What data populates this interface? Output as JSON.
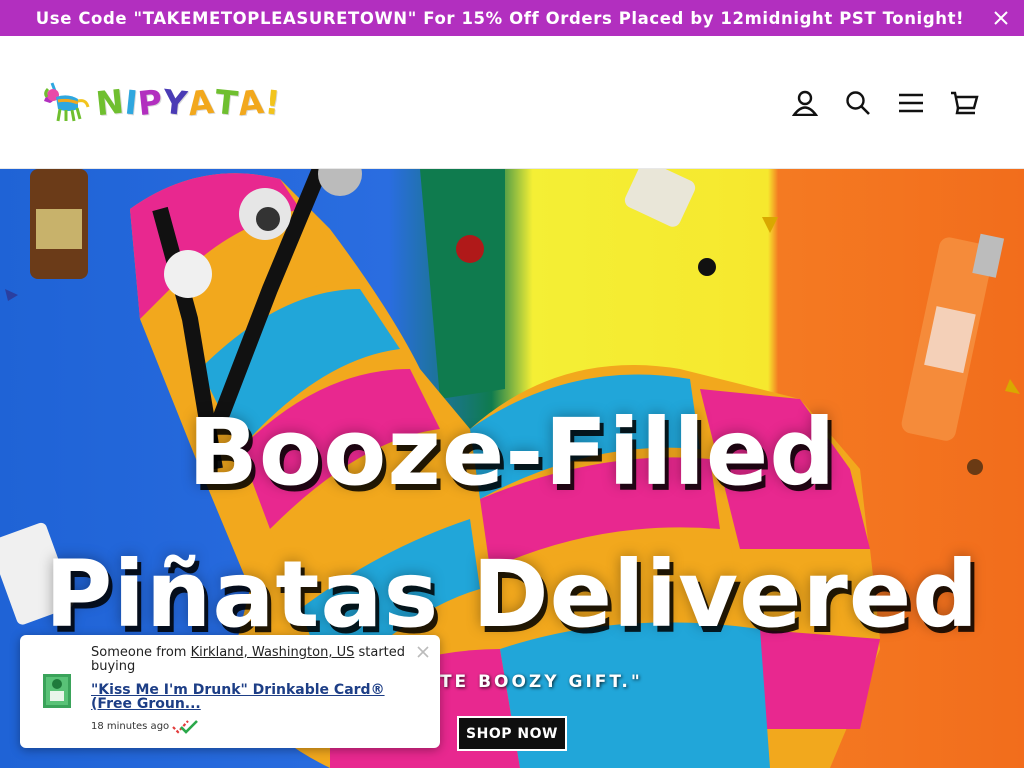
{
  "announcement": {
    "text": "Use Code \"TAKEMETOPLEASURETOWN\" For 15% Off Orders Placed by 12midnight PST Tonight!",
    "close_icon": "close-icon",
    "background": "#b22fbf"
  },
  "header": {
    "logo_text": "NIPYATA!",
    "logo_letters": [
      "N",
      "I",
      "P",
      "Y",
      "A",
      "T",
      "A",
      "!"
    ],
    "logo_colors": [
      "#6fbf2f",
      "#2fa7df",
      "#b22fbf",
      "#4a3bb5",
      "#f2a81d",
      "#6fbf2f",
      "#f2a81d",
      "#f2c41d"
    ],
    "icons": [
      "account-icon",
      "search-icon",
      "menu-icon",
      "cart-icon"
    ]
  },
  "hero": {
    "title_line1": "Booze-Filled",
    "title_line2": "Piñatas Delivered",
    "subtitle": "TIMATE BOOZY GIFT.\"",
    "cta_label": "SHOP NOW"
  },
  "notification": {
    "prefix": "Someone from ",
    "location": "Kirkland, Washington, US",
    "suffix": " started buying",
    "product": "\"Kiss Me I'm Drunk\" Drinkable Card® (Free Groun...",
    "time_ago": "18 minutes ago",
    "verified_icon": "verified-check-icon"
  }
}
